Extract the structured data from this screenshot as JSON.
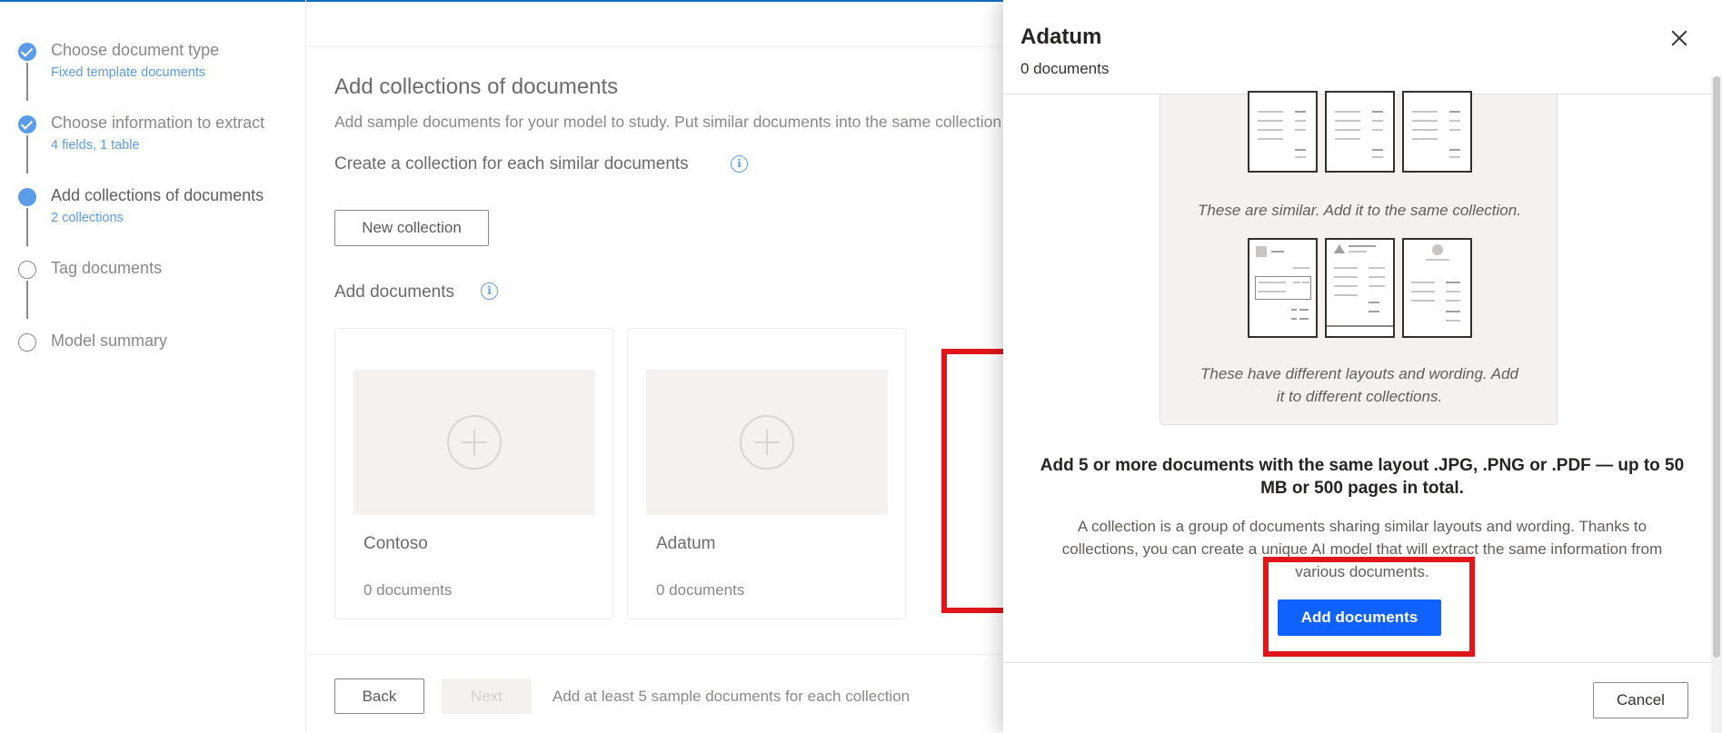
{
  "stepper": {
    "steps": [
      {
        "title": "Choose document type",
        "subtitle": "Fixed template documents",
        "state": "done"
      },
      {
        "title": "Choose information to extract",
        "subtitle": "4 fields, 1 table",
        "state": "done"
      },
      {
        "title": "Add collections of documents",
        "subtitle": "2 collections",
        "state": "current"
      },
      {
        "title": "Tag documents",
        "subtitle": "",
        "state": "todo"
      },
      {
        "title": "Model summary",
        "subtitle": "",
        "state": "todo"
      }
    ]
  },
  "main": {
    "title": "Add collections of documents",
    "description": "Add sample documents for your model to study. Put similar documents into the same collection",
    "collection_heading": "Create a collection for each similar documents",
    "new_collection_label": "New collection",
    "add_documents_heading": "Add documents",
    "collections": [
      {
        "name": "Contoso",
        "count": "0 documents"
      },
      {
        "name": "Adatum",
        "count": "0 documents"
      }
    ],
    "back_label": "Back",
    "next_label": "Next",
    "footer_hint": "Add at least 5 sample documents for each collection"
  },
  "panel": {
    "title": "Adatum",
    "subtitle": "0 documents",
    "similar_caption": "These are similar. Add it to the same collection.",
    "different_caption_line1": "These have different layouts and wording. Add",
    "different_caption_line2": "it to different collections.",
    "heading_line1": "Add 5 or more documents with the same layout .JPG, .PNG or .PDF — up to 50",
    "heading_line2": "MB or 500 pages in total.",
    "description_line1": "A collection is a group of documents sharing similar layouts and wording. Thanks to",
    "description_line2": "collections, you can create a unique AI model that will extract the same information from",
    "description_line3": "various documents.",
    "add_documents_label": "Add documents",
    "cancel_label": "Cancel"
  },
  "colors": {
    "accent": "#0f62fe",
    "step_blue": "#5b9ce8",
    "highlight_red": "#e0161b"
  },
  "icons": [
    "check-icon",
    "info-icon",
    "plus-circle-icon",
    "close-icon"
  ]
}
